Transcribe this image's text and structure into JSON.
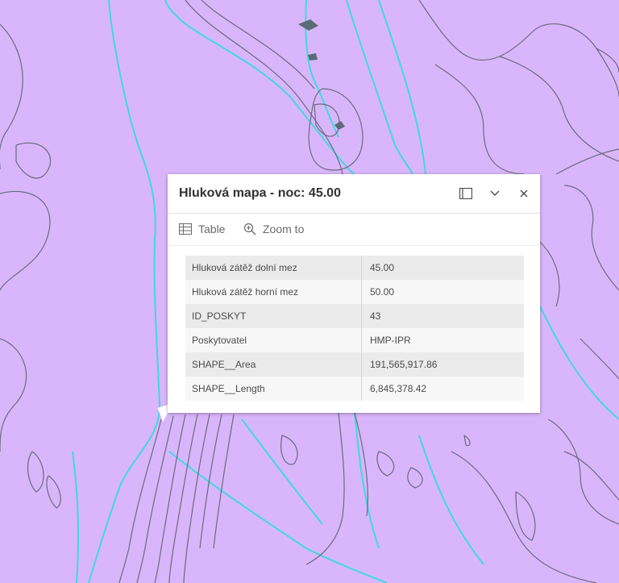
{
  "map": {
    "background_color": "#d9b6fb",
    "contour_color": "#6b6b7a",
    "highlight_color": "#3fd9e4"
  },
  "popup": {
    "title": "Hluková mapa - noc: 45.00",
    "icons": {
      "dock": "dock-icon",
      "collapse": "chevron-down-icon",
      "close": "close-icon"
    },
    "actions": [
      {
        "icon": "table-icon",
        "label": "Table"
      },
      {
        "icon": "zoom-to-icon",
        "label": "Zoom to"
      }
    ],
    "attributes": [
      {
        "name": "Hluková zátěž dolní mez",
        "value": "45.00"
      },
      {
        "name": "Hluková zátěž horní mez",
        "value": "50.00"
      },
      {
        "name": "ID_POSKYT",
        "value": "43"
      },
      {
        "name": "Poskytovatel",
        "value": "HMP-IPR"
      },
      {
        "name": "SHAPE__Area",
        "value": "191,565,917.86"
      },
      {
        "name": "SHAPE__Length",
        "value": "6,845,378.42"
      }
    ]
  }
}
